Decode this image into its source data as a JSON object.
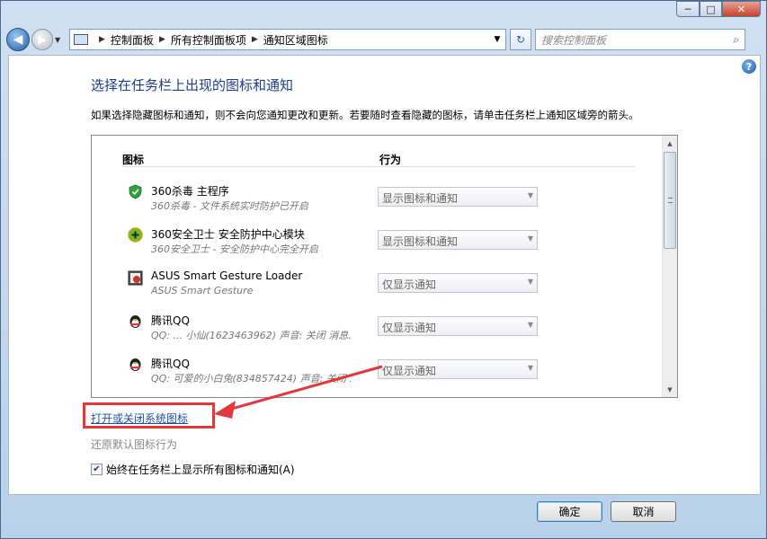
{
  "window": {
    "minimize": "─",
    "maximize": "□",
    "close": "✕"
  },
  "nav": {
    "back_glyph": "◀",
    "forward_glyph": "▶",
    "dropdown_glyph": "▼"
  },
  "address": {
    "crumbs": [
      "控制面板",
      "所有控制面板项",
      "通知区域图标"
    ],
    "separator": "▶",
    "dropdown_glyph": "▼"
  },
  "refresh_glyph": "↻",
  "search": {
    "placeholder": "搜索控制面板",
    "icon_glyph": "⌕"
  },
  "help_glyph": "?",
  "page": {
    "title": "选择在任务栏上出现的图标和通知",
    "description": "如果选择隐藏图标和通知，则不会向您通知更改和更新。若要随时查看隐藏的图标，请单击任务栏上通知区域旁的箭头。"
  },
  "table": {
    "col_icon": "图标",
    "col_behavior": "行为",
    "rows": [
      {
        "name": "360杀毒 主程序",
        "sub": "360杀毒 - 文件系统实时防护已开启",
        "behavior": "显示图标和通知",
        "icon": "shield-icon",
        "color": "#2fa33a"
      },
      {
        "name": "360安全卫士 安全防护中心模块",
        "sub": "360安全卫士 - 安全防护中心完全开启",
        "behavior": "显示图标和通知",
        "icon": "plus-circle-icon",
        "color": "#6bbf2a"
      },
      {
        "name": "ASUS Smart Gesture Loader",
        "sub": "ASUS Smart Gesture",
        "behavior": "仅显示通知",
        "icon": "touchpad-icon",
        "color": "#c0392b"
      },
      {
        "name": "腾讯QQ",
        "sub": "QQ: ... 小仙(1623463962)  声音: 关闭  消息...",
        "behavior": "仅显示通知",
        "icon": "penguin-icon",
        "color": "#e6a100"
      },
      {
        "name": "腾讯QQ",
        "sub": "QQ: 可爱的小白兔(834857424)  声音: 关闭 ...",
        "behavior": "仅显示通知",
        "icon": "penguin-icon",
        "color": "#e6a100"
      }
    ],
    "select_arrow": "▼"
  },
  "links": {
    "toggle_system_icons": "打开或关闭系统图标",
    "restore_defaults": "还原默认图标行为"
  },
  "checkbox": {
    "label": "始终在任务栏上显示所有图标和通知(A)",
    "checked_glyph": "✔"
  },
  "buttons": {
    "ok": "确定",
    "cancel": "取消"
  },
  "annotation_color": "#e3373c"
}
